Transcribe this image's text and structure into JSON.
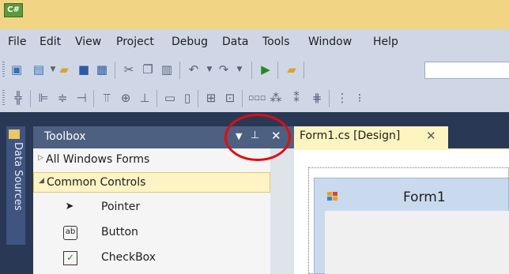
{
  "window": {
    "app_icon_text": "C#"
  },
  "menu": [
    {
      "label": "File"
    },
    {
      "label": "Edit"
    },
    {
      "label": "View"
    },
    {
      "label": "Project"
    },
    {
      "label": "Debug"
    },
    {
      "label": "Data"
    },
    {
      "label": "Tools"
    },
    {
      "label": "Window"
    },
    {
      "label": "Help"
    }
  ],
  "data_sources_tab": {
    "label": "Data Sources"
  },
  "toolbox": {
    "title": "Toolbox",
    "groups": [
      {
        "label": "All Windows Forms",
        "expanded": false
      },
      {
        "label": "Common Controls",
        "expanded": true
      }
    ],
    "tools": [
      {
        "label": "Pointer",
        "icon": "pointer-arrow-icon"
      },
      {
        "label": "Button",
        "icon": "button-ab-icon",
        "glyph": "ab"
      },
      {
        "label": "CheckBox",
        "icon": "checkbox-icon"
      }
    ]
  },
  "document": {
    "tab_label": "Form1.cs [Design]",
    "form_title": "Form1"
  },
  "colors": {
    "highlight": "#e10d0d",
    "title_bar": "#f2d584",
    "panel_header": "#4d6082"
  }
}
